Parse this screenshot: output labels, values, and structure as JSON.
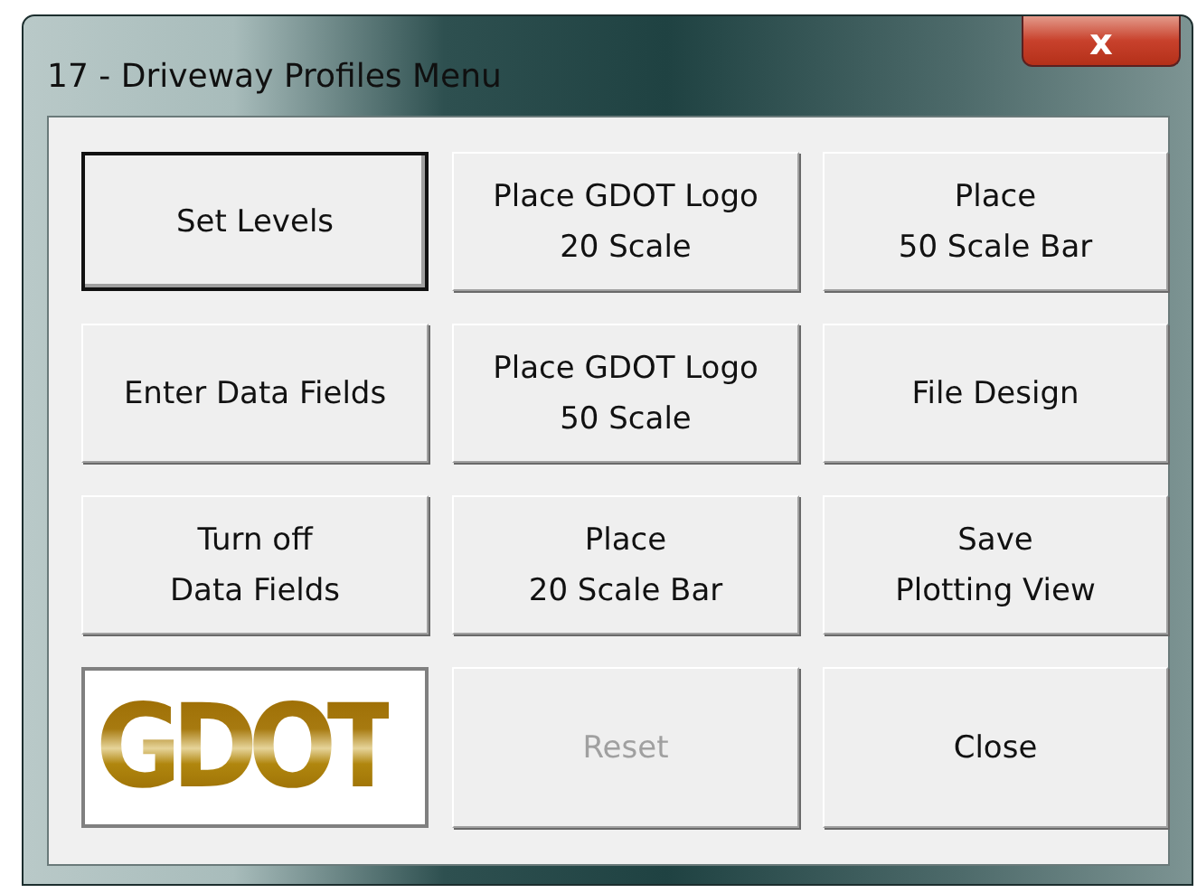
{
  "window": {
    "title": "17 - Driveway Profiles Menu",
    "close": "x"
  },
  "buttons": [
    {
      "kind": "button",
      "label": "Set Levels",
      "default": true,
      "disabled": false
    },
    {
      "kind": "button",
      "label": "Place GDOT Logo\n20 Scale",
      "default": false,
      "disabled": false
    },
    {
      "kind": "button",
      "label": "Place\n50 Scale Bar",
      "default": false,
      "disabled": false
    },
    {
      "kind": "button",
      "label": "Enter Data Fields",
      "default": false,
      "disabled": false
    },
    {
      "kind": "button",
      "label": "Place GDOT Logo\n50 Scale",
      "default": false,
      "disabled": false
    },
    {
      "kind": "button",
      "label": "File Design",
      "default": false,
      "disabled": false
    },
    {
      "kind": "button",
      "label": "Turn off\nData Fields",
      "default": false,
      "disabled": false
    },
    {
      "kind": "button",
      "label": "Place\n20 Scale Bar",
      "default": false,
      "disabled": false
    },
    {
      "kind": "button",
      "label": "Save\nPlotting View",
      "default": false,
      "disabled": false
    },
    {
      "kind": "logo",
      "label": "GDOT"
    },
    {
      "kind": "button",
      "label": "Reset",
      "default": false,
      "disabled": true
    },
    {
      "kind": "button",
      "label": "Close",
      "default": false,
      "disabled": false
    }
  ]
}
